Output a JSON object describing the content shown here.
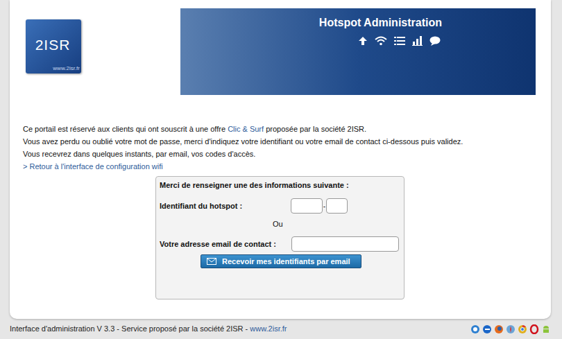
{
  "logo": {
    "name": "2ISR",
    "url": "www.2isr.fr"
  },
  "header": {
    "title": "Hotspot Administration"
  },
  "intro": {
    "line1_before": "Ce portail est réservé aux clients qui ont souscrit à une offre ",
    "offer_link": "Clic & Surf",
    "line1_after": " proposée par la société 2ISR.",
    "line2": "Vous avez perdu ou oublié votre mot de passe, merci d'indiquez votre identifiant ou votre email de contact ci-dessous puis validez.",
    "line3": "Vous recevrez dans quelques instants, par email, vos codes d'accès.",
    "back_link": "> Retour à l'interface de configuration wifi"
  },
  "form": {
    "title": "Merci de renseigner une des informations suivante :",
    "hotspot_label": "Identifiant du hotspot :",
    "hotspot_separator": "-",
    "or": "Ou",
    "email_label": "Votre adresse email de contact :",
    "submit": "Recevoir mes identifiants par email"
  },
  "footer": {
    "text": "Interface d'administration V 3.3 - Service proposé par la société 2ISR - ",
    "link": "www.2isr.fr"
  }
}
